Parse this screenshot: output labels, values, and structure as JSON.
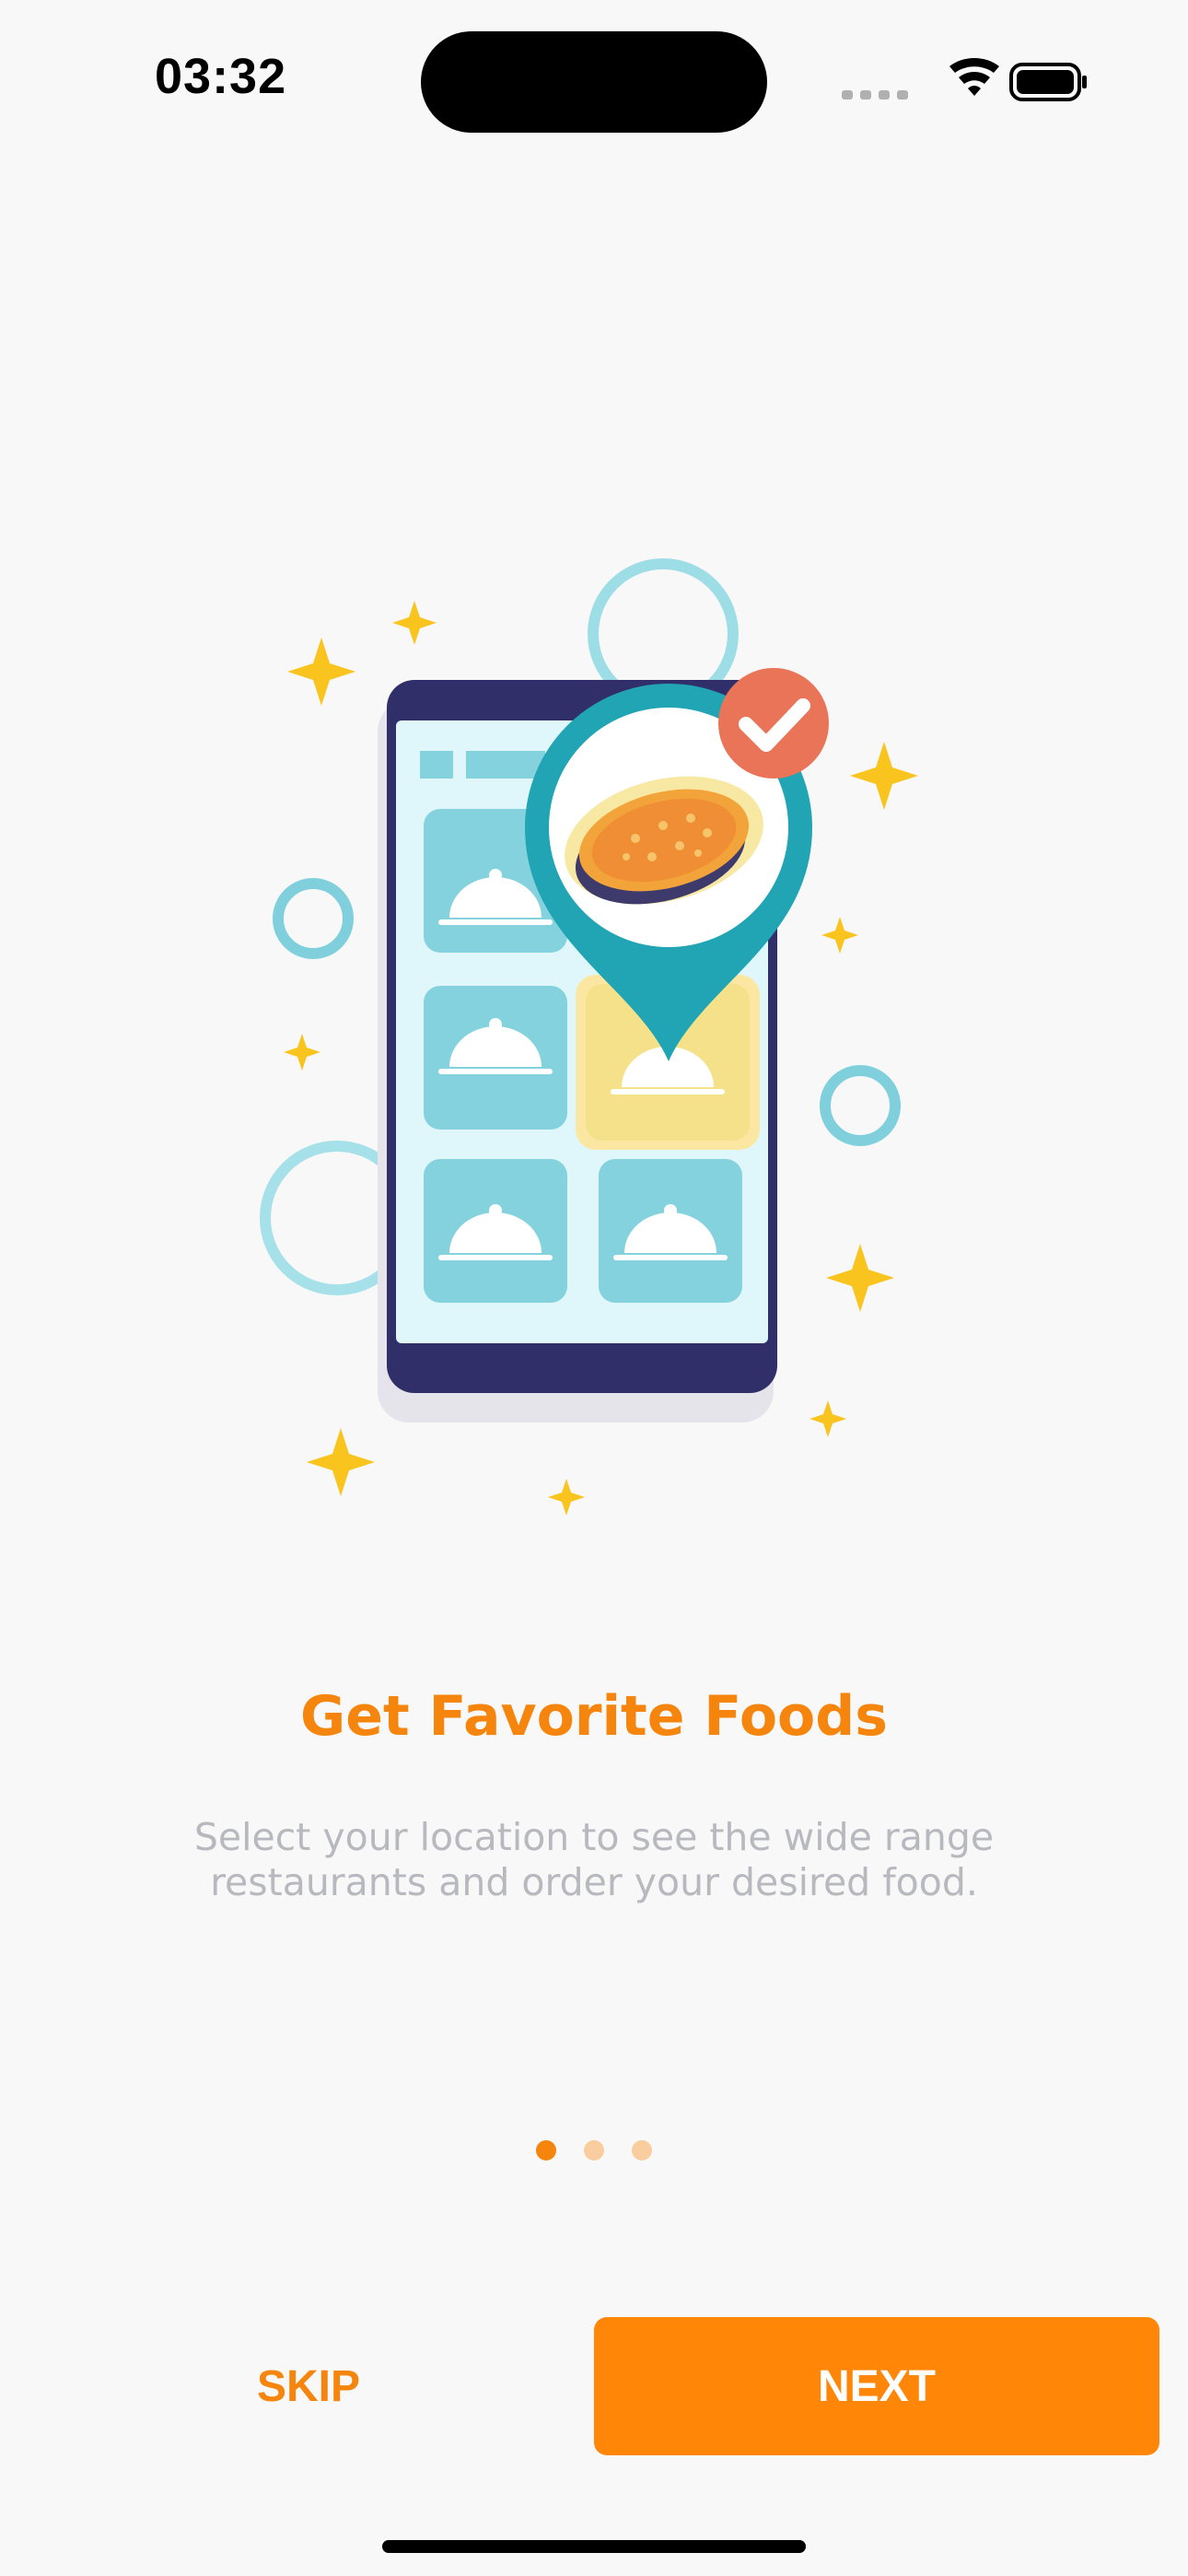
{
  "status_bar": {
    "time": "03:32"
  },
  "illustration": {
    "icon": "phone-food-location-illustration"
  },
  "onboarding": {
    "title": "Get Favorite Foods",
    "description": "Select your location to see the wide range restaurants and order your desired food."
  },
  "pagination": {
    "total": 3,
    "current": 1
  },
  "actions": {
    "skip_label": "SKIP",
    "next_label": "NEXT"
  },
  "colors": {
    "accent": "#ff8606",
    "background": "#f8f8f8",
    "subtitle": "#b8b8bf"
  }
}
